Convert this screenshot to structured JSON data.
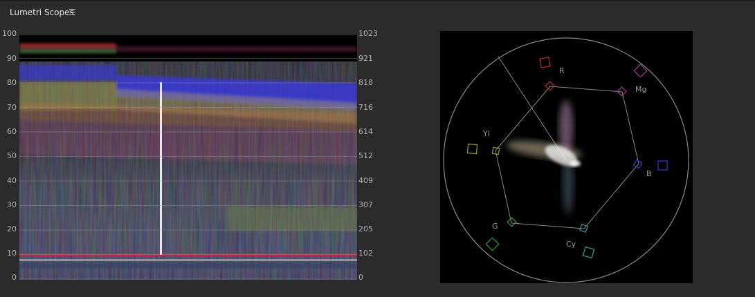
{
  "panel": {
    "title": "Lumetri Scopes",
    "menu_icon": "hamburger-menu-icon"
  },
  "waveform": {
    "left_scale": [
      "100",
      "90",
      "80",
      "70",
      "60",
      "50",
      "40",
      "30",
      "20",
      "10",
      "0"
    ],
    "right_scale": [
      "1023",
      "921",
      "818",
      "716",
      "614",
      "512",
      "409",
      "307",
      "205",
      "102",
      "0"
    ],
    "background": "#000000"
  },
  "vectorscope": {
    "labels": {
      "r": "R",
      "mg": "Mg",
      "b": "B",
      "cy": "Cy",
      "g": "G",
      "yl": "Yl"
    },
    "colors": {
      "r": "#b0312a",
      "mg": "#a338a3",
      "b": "#3a3ad0",
      "cy": "#2a9c9c",
      "g": "#2f9a3a",
      "yl": "#9a9a3a"
    }
  }
}
